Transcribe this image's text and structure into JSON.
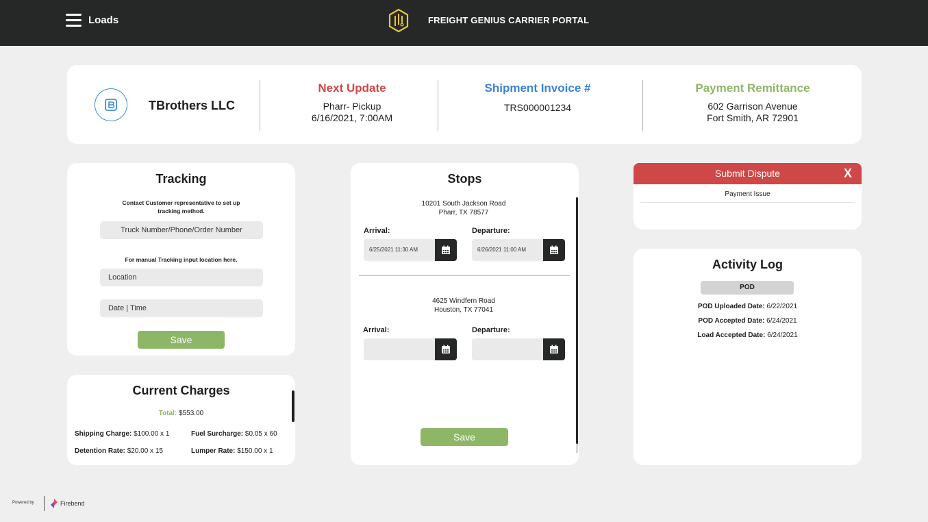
{
  "header": {
    "nav_title": "Loads",
    "portal_title": "FREIGHT GENIUS CARRIER PORTAL"
  },
  "summary": {
    "company": "TBrothers LLC",
    "next_update": {
      "heading": "Next Update",
      "line1": "Pharr- Pickup",
      "line2": "6/16/2021, 7:00AM"
    },
    "invoice": {
      "heading": "Shipment Invoice #",
      "value": "TRS000001234"
    },
    "remittance": {
      "heading": "Payment Remittance",
      "line1": "602 Garrison Avenue",
      "line2": "Fort Smith, AR 72901"
    }
  },
  "tracking": {
    "title": "Tracking",
    "note1_line1": "Contact Customer representative to set up",
    "note1_line2": "tracking method.",
    "truck_placeholder": "Truck Number/Phone/Order Number",
    "note2": "For manual Tracking input location here.",
    "location_placeholder": "Location",
    "datetime_placeholder": "Date | Time",
    "save_label": "Save"
  },
  "charges": {
    "title": "Current Charges",
    "total_label": "Total:",
    "total_value": "$553.00",
    "items": [
      {
        "label": "Shipping Charge:",
        "value": "$100.00 x 1"
      },
      {
        "label": "Fuel Surcharge:",
        "value": "$0.05 x 60"
      },
      {
        "label": "Detention Rate:",
        "value": "$20.00 x 15"
      },
      {
        "label": "Lumper Rate:",
        "value": "$150.00 x 1"
      }
    ]
  },
  "stops": {
    "title": "Stops",
    "arrival_label": "Arrival:",
    "departure_label": "Departure:",
    "save_label": "Save",
    "list": [
      {
        "addr1": "10201 South Jackson Road",
        "addr2": "Pharr, TX 78577",
        "arrival": "6/25/2021 11:30 AM",
        "departure": "6/26/2021 11:00 AM"
      },
      {
        "addr1": "4625 Windfern Road",
        "addr2": "Houston, TX 77041",
        "arrival": "",
        "departure": ""
      }
    ]
  },
  "dispute": {
    "title": "Submit Dispute",
    "close": "X",
    "reason": "Payment Issue"
  },
  "activity": {
    "title": "Activity Log",
    "tab": "POD",
    "entries": [
      {
        "label": "POD Uploaded Date:",
        "value": "6/22/2021"
      },
      {
        "label": "POD Accepted Date:",
        "value": "6/24/2021"
      },
      {
        "label": "Load Accepted Date:",
        "value": "6/24/2021"
      }
    ]
  },
  "footer": {
    "powered_by": "Powered by",
    "brand": "Firebend"
  },
  "colors": {
    "topbar": "#262828",
    "red": "#cf4747",
    "blue": "#3b82d6",
    "green": "#8db767",
    "logo_gold": "#e8c63a"
  }
}
